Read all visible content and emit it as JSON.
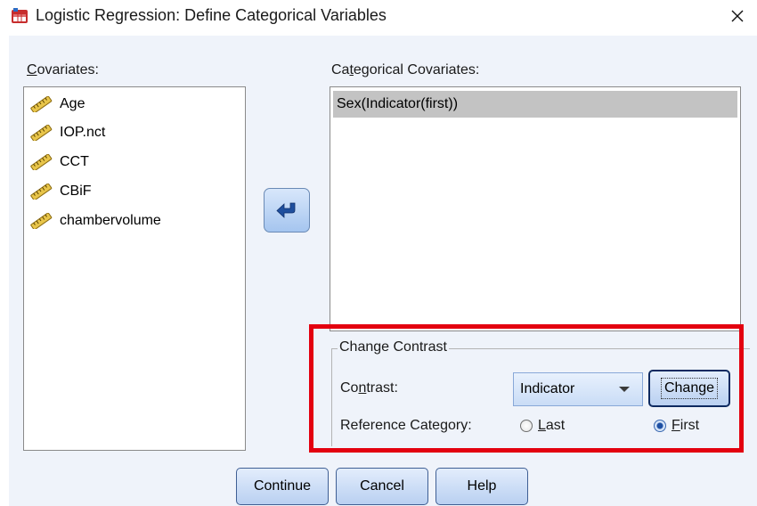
{
  "window": {
    "title": "Logistic Regression: Define Categorical Variables",
    "close_glyph": "✕"
  },
  "covariates": {
    "label_first": "C",
    "label_rest": "ovariates:",
    "items": [
      {
        "icon": "scale-ruler-icon",
        "label": "Age"
      },
      {
        "icon": "scale-ruler-icon",
        "label": "IOP.nct"
      },
      {
        "icon": "scale-ruler-icon",
        "label": "CCT"
      },
      {
        "icon": "scale-ruler-icon",
        "label": "CBiF"
      },
      {
        "icon": "scale-ruler-icon",
        "label": "chambervolume"
      }
    ]
  },
  "move_button": {
    "icon": "arrow-left-icon"
  },
  "categorical": {
    "label_a": "Ca",
    "label_u": "t",
    "label_b": "egorical Covariates:",
    "items": [
      "Sex(Indicator(first))"
    ]
  },
  "change_contrast": {
    "title": "Change Contrast",
    "contrast_label_a": "Co",
    "contrast_label_u": "n",
    "contrast_label_b": "trast:",
    "contrast_value": "Indicator",
    "change_button": "Change",
    "reference_label": "Reference Category:",
    "last_u": "L",
    "last_rest": "ast",
    "first_u": "F",
    "first_rest": "irst",
    "selected": "First"
  },
  "buttons": {
    "continue": "Continue",
    "cancel": "Cancel",
    "help": "Help"
  },
  "colors": {
    "highlight": "#e3000f",
    "selection": "#c3c3c3",
    "dialog_bg": "#eff3fa"
  }
}
